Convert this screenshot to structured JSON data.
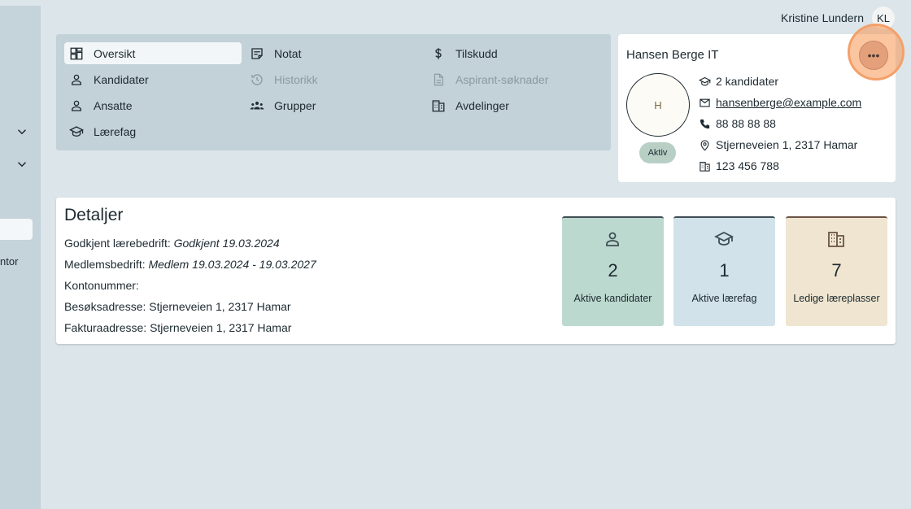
{
  "sidebar": {
    "partial_text": "ntor"
  },
  "user": {
    "name": "Kristine Lundern",
    "initials": "KL"
  },
  "nav": {
    "items": [
      {
        "label": "Oversikt",
        "icon": "dashboard-icon",
        "state": "active"
      },
      {
        "label": "Notat",
        "icon": "note-icon",
        "state": "normal"
      },
      {
        "label": "Tilskudd",
        "icon": "dollar-icon",
        "state": "normal"
      },
      {
        "label": "Kandidater",
        "icon": "person-icon",
        "state": "normal"
      },
      {
        "label": "Historikk",
        "icon": "history-icon",
        "state": "disabled"
      },
      {
        "label": "Aspirant-søknader",
        "icon": "document-icon",
        "state": "disabled"
      },
      {
        "label": "Ansatte",
        "icon": "person-icon",
        "state": "normal"
      },
      {
        "label": "Grupper",
        "icon": "groups-icon",
        "state": "normal"
      },
      {
        "label": "Avdelinger",
        "icon": "building-icon",
        "state": "normal"
      },
      {
        "label": "Lærefag",
        "icon": "school-icon",
        "state": "normal"
      }
    ]
  },
  "company": {
    "name": "Hansen Berge IT",
    "avatar_letter": "H",
    "status": "Aktiv",
    "more_icon": "more-horizontal-icon",
    "contacts": {
      "candidates": "2 kandidater",
      "email": "hansenberge@example.com",
      "phone": "88 88 88 88",
      "address": "Stjerneveien 1, 2317 Hamar",
      "org_number": "123 456 788"
    }
  },
  "details": {
    "title": "Detaljer",
    "rows": [
      {
        "label": "Godkjent lærebedrift:",
        "value": "Godkjent 19.03.2024",
        "italic": true
      },
      {
        "label": "Medlemsbedrift:",
        "value": "Medlem 19.03.2024 - 19.03.2027",
        "italic": true
      },
      {
        "label": "Kontonummer:",
        "value": "",
        "italic": false
      },
      {
        "label": "Besøksadresse:",
        "value": "Stjerneveien 1, 2317 Hamar",
        "italic": false
      },
      {
        "label": "Fakturaadresse:",
        "value": "Stjerneveien 1, 2317 Hamar",
        "italic": false
      }
    ]
  },
  "stats": [
    {
      "value": "2",
      "label": "Aktive kandidater",
      "icon": "person-icon",
      "color": "#bcd9cf"
    },
    {
      "value": "1",
      "label": "Aktive lærefag",
      "icon": "school-icon",
      "color": "#d1e2ea"
    },
    {
      "value": "7",
      "label": "Ledige læreplasser",
      "icon": "building-icon",
      "color": "#efe5d0"
    }
  ],
  "colors": {
    "background": "#dbe5ea",
    "nav_panel": "#c3d1d8",
    "highlight": "#f7964f"
  }
}
